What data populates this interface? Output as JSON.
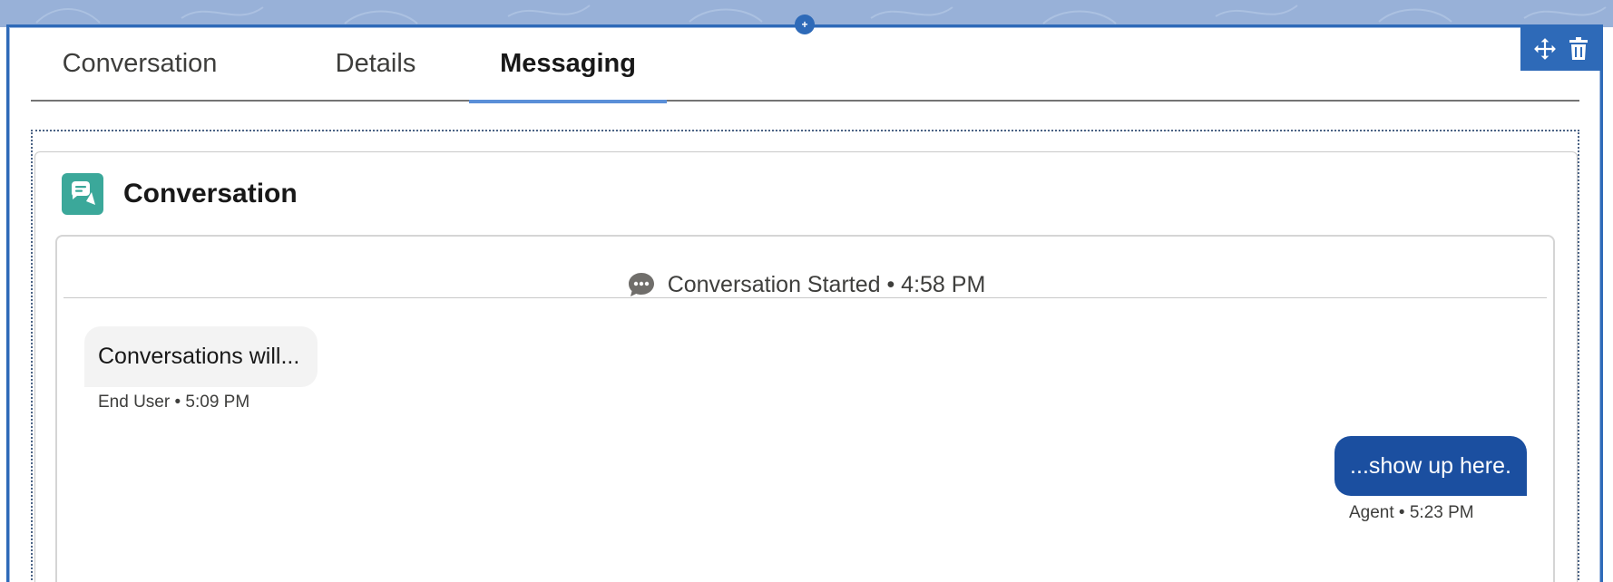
{
  "tabs": [
    {
      "label": "Conversation"
    },
    {
      "label": "Details"
    },
    {
      "label": "Messaging"
    }
  ],
  "active_tab": "Messaging",
  "card": {
    "title": "Conversation",
    "icon": "chat-bubble-icon"
  },
  "conversation": {
    "started_label": "Conversation Started • 4:58 PM",
    "messages": [
      {
        "text": "Conversations will...",
        "meta": "End User • 5:09 PM",
        "direction": "inbound"
      },
      {
        "text": "...show up here.",
        "meta": "Agent • 5:23 PM",
        "direction": "outbound"
      }
    ]
  },
  "toolbar": {
    "move_icon": "move-icon",
    "delete_icon": "trash-icon"
  },
  "colors": {
    "accent": "#2e6ab8",
    "band": "#98b1d8",
    "card_icon_bg": "#3ba89a",
    "agent_bubble": "#1b4fa0",
    "user_bubble": "#f3f3f3",
    "tab_underline": "#5a8fd8"
  }
}
